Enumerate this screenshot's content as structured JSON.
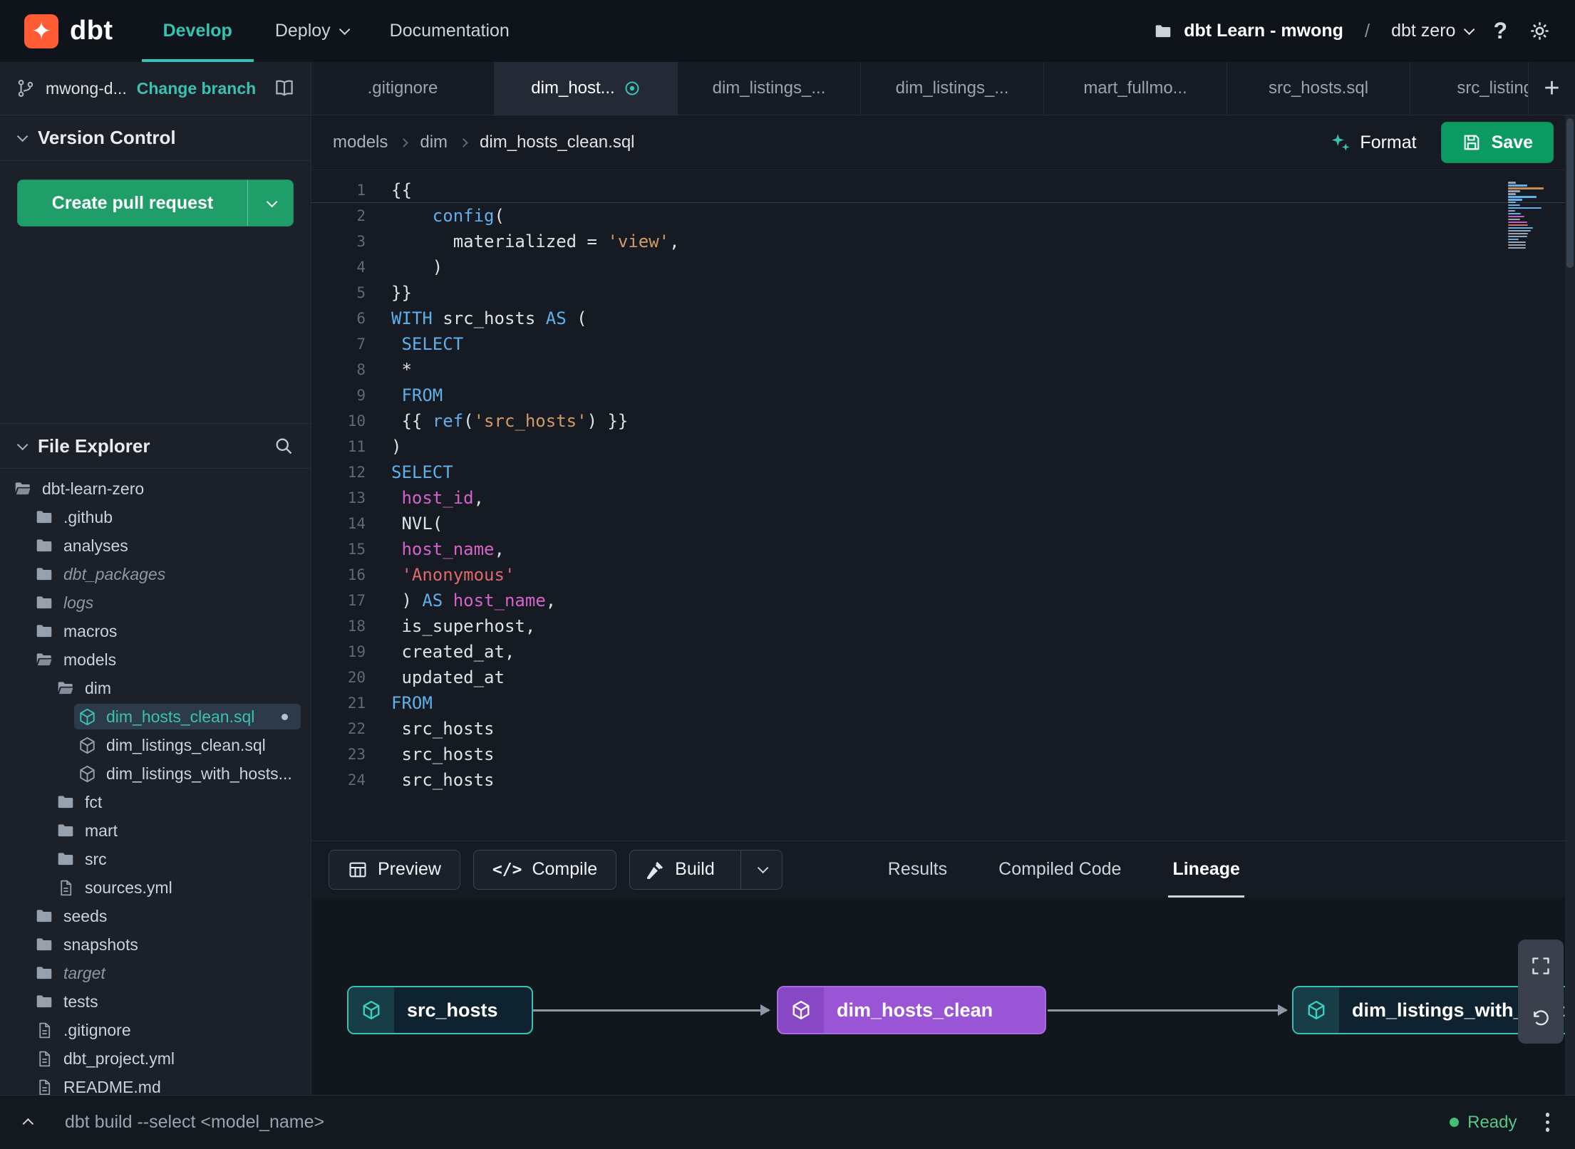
{
  "nav": {
    "logo_text": "dbt",
    "items": [
      {
        "label": "Develop",
        "active": true
      },
      {
        "label": "Deploy",
        "chevron": true
      },
      {
        "label": "Documentation"
      }
    ],
    "project": "dbt Learn - mwong",
    "separator": "/",
    "environment": "dbt zero",
    "help": "?"
  },
  "sidebar": {
    "branch": {
      "name": "mwong-d...",
      "action": "Change branch"
    },
    "version_control": {
      "title": "Version Control",
      "create_pr": "Create pull request"
    },
    "file_explorer": {
      "title": "File Explorer"
    },
    "tree": [
      {
        "label": "dbt-learn-zero",
        "icon": "folder-open",
        "level": 0
      },
      {
        "label": ".github",
        "icon": "folder",
        "level": 1
      },
      {
        "label": "analyses",
        "icon": "folder",
        "level": 1
      },
      {
        "label": "dbt_packages",
        "icon": "folder",
        "level": 1,
        "italic": true
      },
      {
        "label": "logs",
        "icon": "folder",
        "level": 1,
        "italic": true
      },
      {
        "label": "macros",
        "icon": "folder",
        "level": 1
      },
      {
        "label": "models",
        "icon": "folder-open",
        "level": 1
      },
      {
        "label": "dim",
        "icon": "folder-open",
        "level": 2
      },
      {
        "label": "dim_hosts_clean.sql",
        "icon": "model",
        "level": 3,
        "selected": true,
        "modified": true
      },
      {
        "label": "dim_listings_clean.sql",
        "icon": "model",
        "level": 3
      },
      {
        "label": "dim_listings_with_hosts...",
        "icon": "model",
        "level": 3
      },
      {
        "label": "fct",
        "icon": "folder",
        "level": 2
      },
      {
        "label": "mart",
        "icon": "folder",
        "level": 2
      },
      {
        "label": "src",
        "icon": "folder",
        "level": 2
      },
      {
        "label": "sources.yml",
        "icon": "file",
        "level": 2
      },
      {
        "label": "seeds",
        "icon": "folder",
        "level": 1
      },
      {
        "label": "snapshots",
        "icon": "folder",
        "level": 1
      },
      {
        "label": "target",
        "icon": "folder",
        "level": 1,
        "italic": true
      },
      {
        "label": "tests",
        "icon": "folder",
        "level": 1
      },
      {
        "label": ".gitignore",
        "icon": "file",
        "level": 1
      },
      {
        "label": "dbt_project.yml",
        "icon": "file",
        "level": 1
      },
      {
        "label": "README.md",
        "icon": "file",
        "level": 1
      }
    ]
  },
  "tabs": {
    "items": [
      {
        "label": ".gitignore"
      },
      {
        "label": "dim_host...",
        "active": true,
        "modified": true
      },
      {
        "label": "dim_listings_..."
      },
      {
        "label": "dim_listings_..."
      },
      {
        "label": "mart_fullmo..."
      },
      {
        "label": "src_hosts.sql"
      },
      {
        "label": "src_listings."
      }
    ],
    "add_label": "+"
  },
  "breadcrumb": [
    "models",
    "dim",
    "dim_hosts_clean.sql"
  ],
  "editor_actions": {
    "format": "Format",
    "save": "Save"
  },
  "editor": {
    "cursor_line": 1,
    "lines": [
      [
        [
          "p",
          "{{"
        ]
      ],
      [
        [
          "p",
          "    "
        ],
        [
          "k",
          "config"
        ],
        [
          "p",
          "("
        ]
      ],
      [
        [
          "p",
          "      materialized = "
        ],
        [
          "s",
          "'view'"
        ],
        [
          "p",
          ","
        ]
      ],
      [
        [
          "p",
          "    )"
        ]
      ],
      [
        [
          "p",
          "}}"
        ]
      ],
      [
        [
          "k",
          "WITH"
        ],
        [
          "p",
          " src_hosts "
        ],
        [
          "k",
          "AS"
        ],
        [
          "p",
          " ("
        ]
      ],
      [
        [
          "p",
          " "
        ],
        [
          "k",
          "SELECT"
        ]
      ],
      [
        [
          "p",
          " *"
        ]
      ],
      [
        [
          "p",
          " "
        ],
        [
          "k",
          "FROM"
        ]
      ],
      [
        [
          "p",
          " {{ "
        ],
        [
          "k",
          "ref"
        ],
        [
          "p",
          "("
        ],
        [
          "s",
          "'src_hosts'"
        ],
        [
          "p",
          ") }}"
        ]
      ],
      [
        [
          "p",
          ")"
        ]
      ],
      [
        [
          "k",
          "SELECT"
        ]
      ],
      [
        [
          "p",
          " "
        ],
        [
          "f",
          "host_id"
        ],
        [
          "p",
          ","
        ]
      ],
      [
        [
          "p",
          " NVL("
        ]
      ],
      [
        [
          "p",
          " "
        ],
        [
          "f",
          "host_name"
        ],
        [
          "p",
          ","
        ]
      ],
      [
        [
          "p",
          " "
        ],
        [
          "r",
          "'Anonymous'"
        ]
      ],
      [
        [
          "p",
          " ) "
        ],
        [
          "k",
          "AS"
        ],
        [
          "p",
          " "
        ],
        [
          "f",
          "host_name"
        ],
        [
          "p",
          ","
        ]
      ],
      [
        [
          "p",
          " is_superhost,"
        ]
      ],
      [
        [
          "p",
          " created_at,"
        ]
      ],
      [
        [
          "p",
          " updated_at"
        ]
      ],
      [
        [
          "k",
          "FROM"
        ]
      ],
      [
        [
          "p",
          " src_hosts"
        ]
      ],
      [
        [
          "p",
          " src_hosts"
        ]
      ],
      [
        [
          "p",
          " src_hosts"
        ]
      ]
    ]
  },
  "toolbar": {
    "buttons": [
      {
        "label": "Preview",
        "icon": "table"
      },
      {
        "label": "Compile",
        "icon": "code"
      },
      {
        "label": "Build",
        "icon": "hammer",
        "split": true
      }
    ],
    "tabs": [
      {
        "label": "Results"
      },
      {
        "label": "Compiled Code"
      },
      {
        "label": "Lineage",
        "active": true
      }
    ]
  },
  "lineage": {
    "nodes": [
      {
        "label": "src_hosts",
        "kind": "source"
      },
      {
        "label": "dim_hosts_clean",
        "kind": "model"
      },
      {
        "label": "dim_listings_with_hosts",
        "kind": "source"
      }
    ]
  },
  "command_bar": {
    "command": "dbt build --select <model_name>",
    "status": "Ready"
  },
  "colors": {
    "accent": "#35c3b4",
    "logo_orange": "#ff5c35",
    "pr_green": "#1f9e69",
    "save_green": "#0a9a62",
    "model_purple": "#9a55d6",
    "ready_green": "#57c785"
  }
}
